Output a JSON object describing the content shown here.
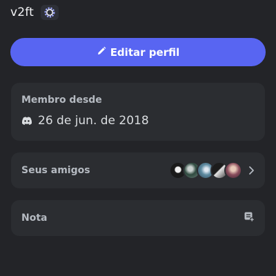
{
  "profile": {
    "username": "v2ft",
    "badge_icon": "settings-gear-badge-icon",
    "accent_color": "#5865f2"
  },
  "edit_button": {
    "label": "Editar perfil",
    "icon": "pencil-icon"
  },
  "member_since": {
    "label": "Membro desde",
    "icon": "discord-icon",
    "date": "26 de jun. de 2018"
  },
  "friends": {
    "label": "Seus amigos",
    "avatar_count": 5,
    "chevron_icon": "chevron-right-icon"
  },
  "note": {
    "label": "Nota",
    "icon": "note-add-icon"
  }
}
